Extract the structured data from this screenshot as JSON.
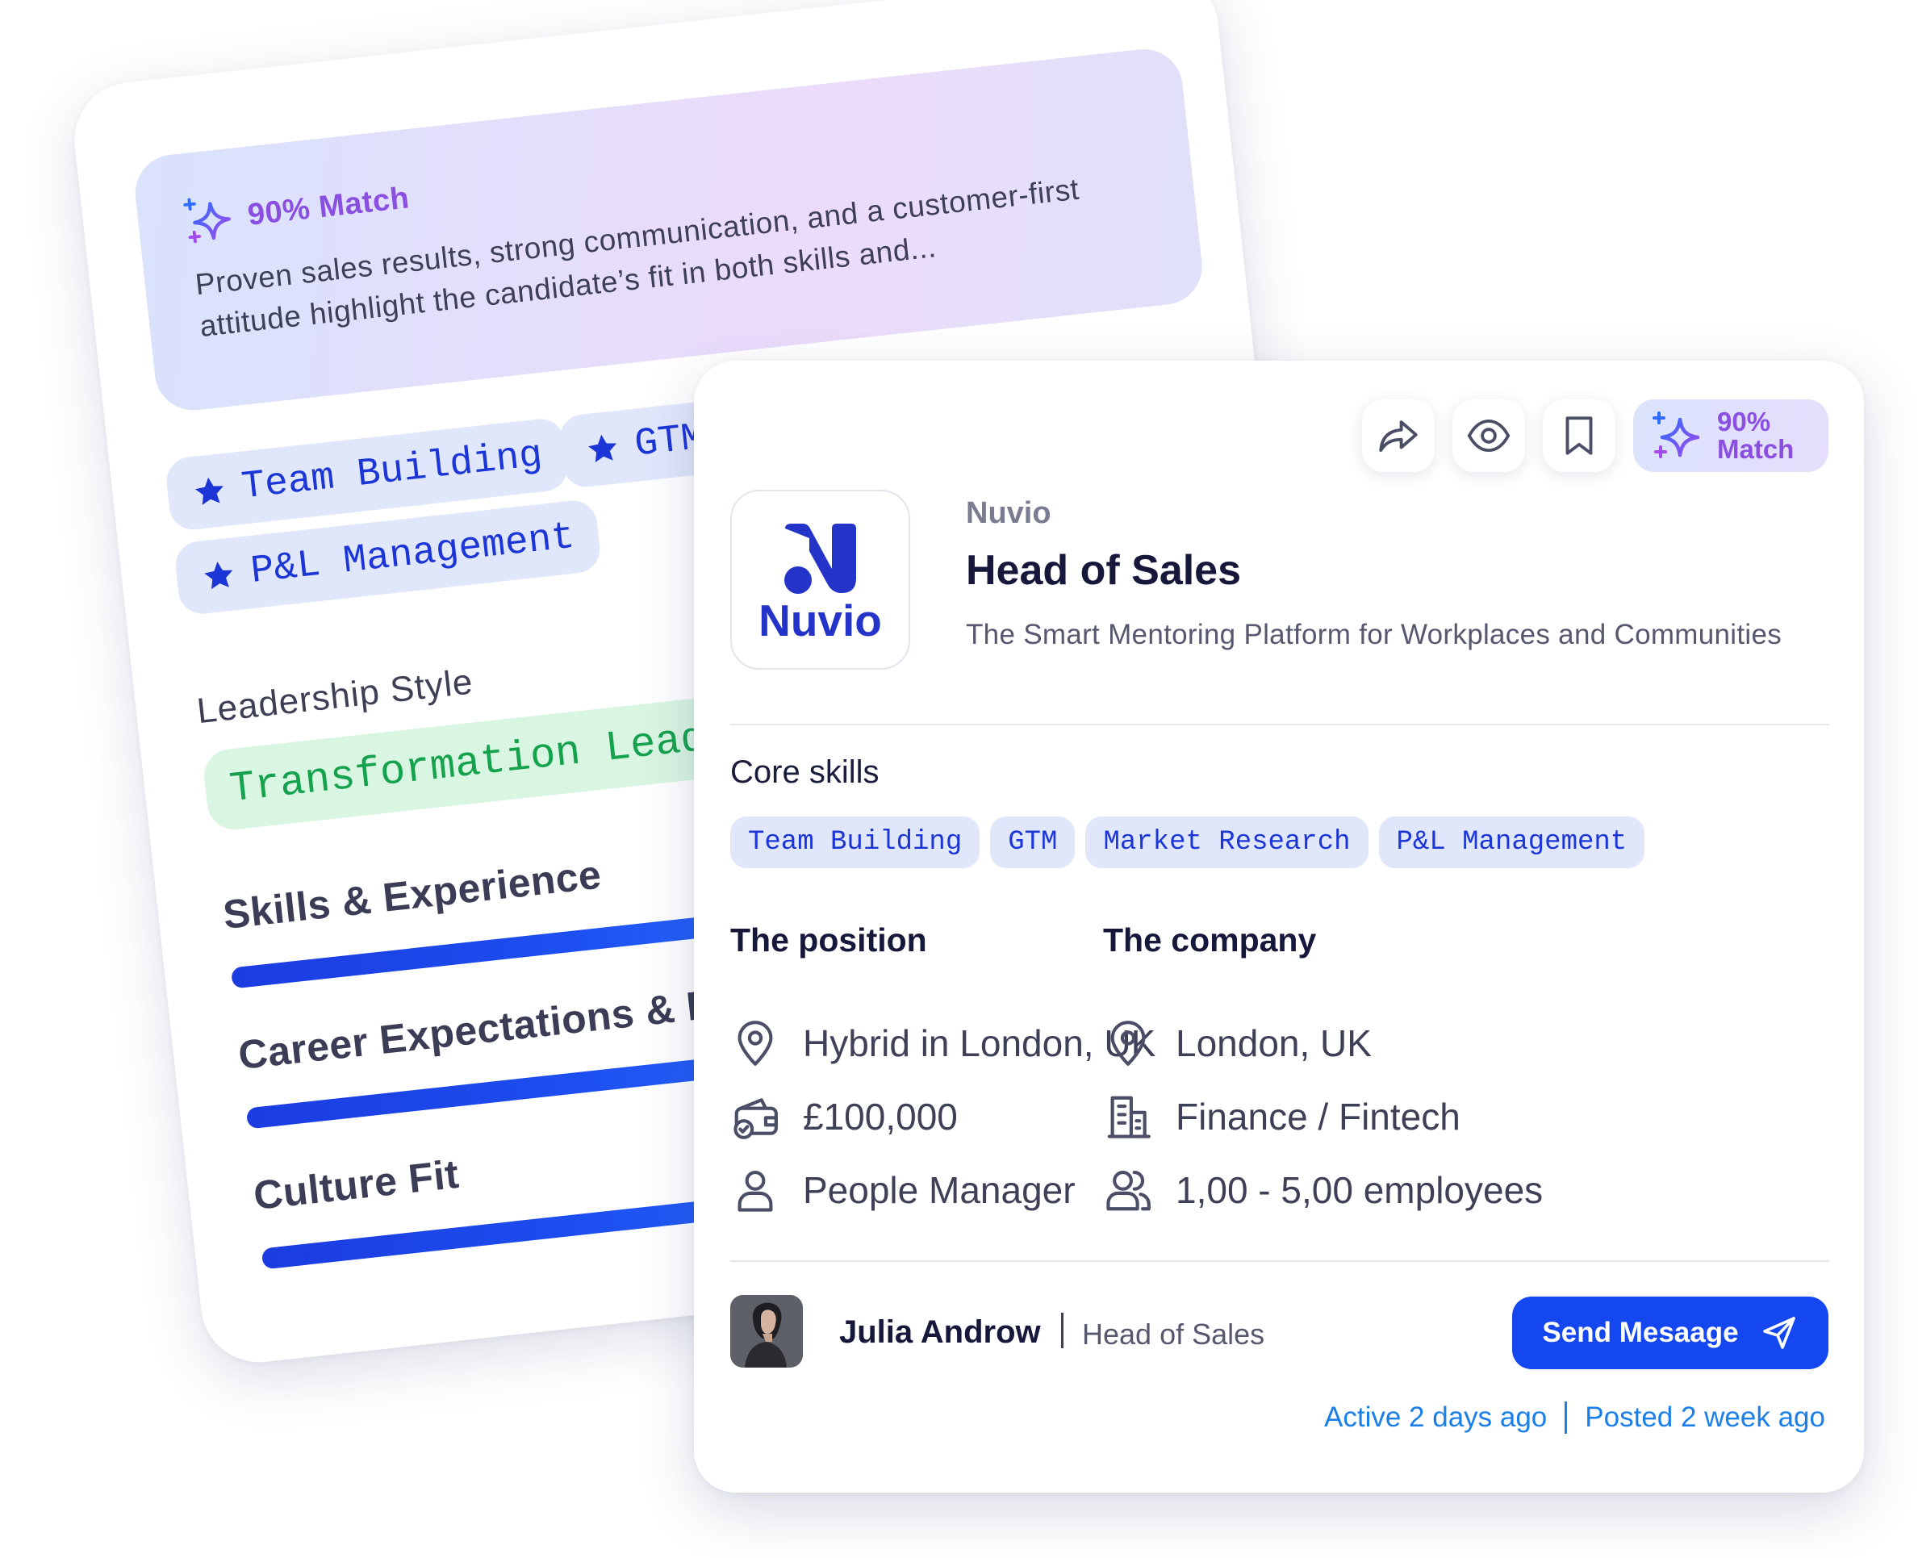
{
  "back_card": {
    "match_label": "90% Match",
    "match_description": "Proven sales results, strong communication, and a customer-first attitude highlight the candidate’s fit in both skills and...",
    "highlight_skills": [
      "Team Building",
      "GTM",
      "P&L Management"
    ],
    "leadership_label": "Leadership Style",
    "leadership_value": "Transformation Leadership",
    "scores": [
      {
        "label": "Skills & Experience"
      },
      {
        "label": "Career Expectations & Preferences"
      },
      {
        "label": "Culture Fit"
      }
    ]
  },
  "job": {
    "company": "Nuvio",
    "logo_text": "Nuvio",
    "title": "Head of Sales",
    "tagline": "The Smart Mentoring Platform for Workplaces and Communities",
    "match_line1": "90%",
    "match_line2": "Match",
    "core_skills_label": "Core skills",
    "core_skills": [
      "Team Building",
      "GTM",
      "Market Research",
      "P&L Management"
    ],
    "position": {
      "heading": "The position",
      "location": "Hybrid in London, UK",
      "salary": "£100,000",
      "role_type": "People Manager"
    },
    "company_info": {
      "heading": "The company",
      "location": "London, UK",
      "industry": "Finance / Fintech",
      "size": "1,00 - 5,00 employees"
    },
    "recruiter": {
      "name": "Julia Androw",
      "role": "Head of Sales"
    },
    "send_label": "Send Mesaage",
    "active": "Active 2 days ago",
    "posted": "Posted 2 week ago"
  },
  "colors": {
    "primary": "#1447f0",
    "skill_text": "#1b35d6",
    "skill_bg": "#e1e7fb",
    "match_purple": "#8a4fe0",
    "leadership_green": "#15a24d",
    "status_blue": "#1a7fe8"
  },
  "icons": [
    "sparkle-icon",
    "share-icon",
    "eye-icon",
    "bookmark-icon",
    "star-icon",
    "location-pin-icon",
    "wallet-icon",
    "person-icon",
    "building-icon",
    "users-icon",
    "send-icon"
  ]
}
